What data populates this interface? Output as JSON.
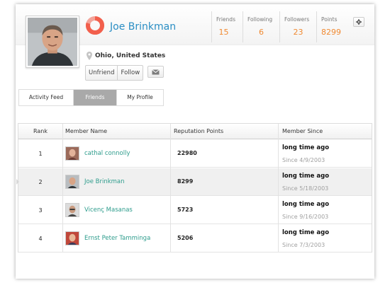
{
  "profile": {
    "name": "Joe Brinkman",
    "location": "Ohio, United States",
    "avatar_icon": "profile-photo",
    "accent_color": "#2a8ec4",
    "donut_colors": [
      "#f25f4c",
      "#f3a49a"
    ]
  },
  "actions": {
    "unfriend_label": "Unfriend",
    "follow_label": "Follow",
    "message_icon": "envelope-icon"
  },
  "stats": {
    "friends": {
      "label": "Friends",
      "value": "15"
    },
    "following": {
      "label": "Following",
      "value": "6"
    },
    "followers": {
      "label": "Followers",
      "value": "23"
    },
    "points": {
      "label": "Points",
      "value": "8299"
    },
    "value_color": "#f08a32",
    "settings_icon": "gear-icon"
  },
  "tabs": [
    {
      "label": "Activity Feed",
      "active": false
    },
    {
      "label": "Friends",
      "active": true
    },
    {
      "label": "My Profile",
      "active": false
    }
  ],
  "table": {
    "columns": [
      "Rank",
      "Member Name",
      "Reputation Points",
      "Member Since"
    ],
    "rows": [
      {
        "rank": "1",
        "name": "cathal connolly",
        "points": "22980",
        "since_title": "long time ago",
        "since_date": "Since 4/9/2003"
      },
      {
        "rank": "2",
        "name": "Joe Brinkman",
        "points": "8299",
        "since_title": "long time ago",
        "since_date": "Since 5/18/2003"
      },
      {
        "rank": "3",
        "name": "Vicenç Masanas",
        "points": "5723",
        "since_title": "long time ago",
        "since_date": "Since 9/16/2003"
      },
      {
        "rank": "4",
        "name": "Ernst Peter Tamminga",
        "points": "5206",
        "since_title": "long time ago",
        "since_date": "Since 7/3/2003"
      }
    ],
    "link_color": "#2d9c8c"
  }
}
